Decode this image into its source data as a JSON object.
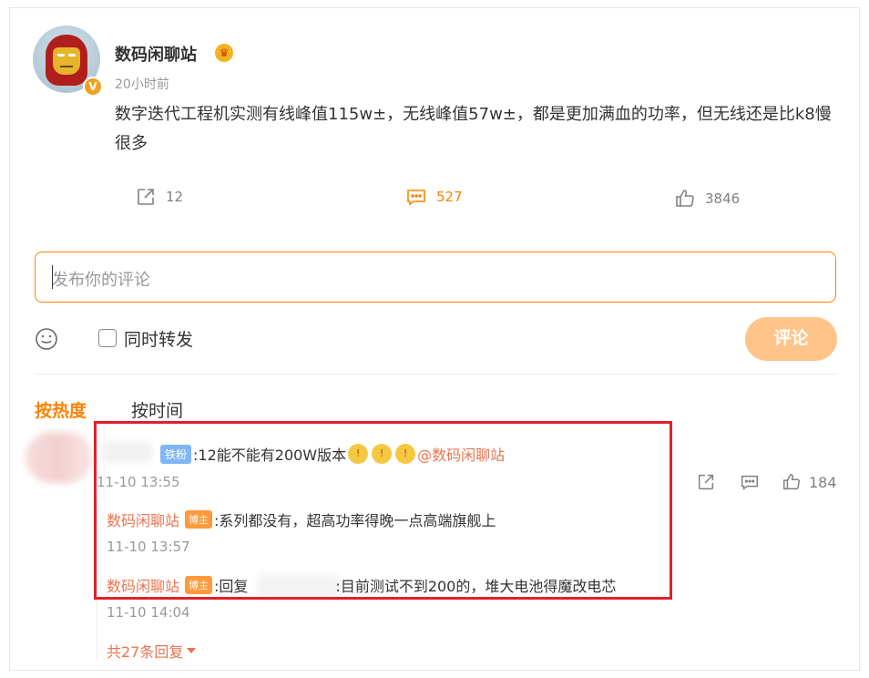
{
  "post": {
    "author": "数码闲聊站",
    "crown_icon": "crown-emoji-icon",
    "verified_icon": "v-verified-icon",
    "time": "20小时前",
    "text": "数字迭代工程机实测有线峰值115w±，无线峰值57w±，都是更加满血的功率，但无线还是比k8慢很多",
    "share_count": "12",
    "comment_count": "527",
    "like_count": "3846"
  },
  "composer": {
    "placeholder": "发布你的评论",
    "repost_label": "同时转发",
    "submit_label": "评论",
    "emoji_icon": "smile-icon"
  },
  "sort": {
    "hot": "按热度",
    "time": "按时间"
  },
  "comment": {
    "fan_badge": "铁粉",
    "text": ":12能不能有200W版本",
    "mention": "@数码闲聊站",
    "time": "11-10 13:55",
    "like_count": "184",
    "replies": [
      {
        "author": "数码闲聊站",
        "badge": "博主",
        "text": ":系列都没有，超高功率得晚一点高端旗舰上",
        "time": "11-10 13:57"
      },
      {
        "author": "数码闲聊站",
        "badge": "博主",
        "prefix": ":回复",
        "text": ":目前测试不到200的，堆大电池得魔改电芯",
        "time": "11-10 14:04"
      }
    ],
    "more_replies": "共27条回复"
  },
  "colors": {
    "accent": "#ff8200",
    "author": "#eb7350",
    "highlight": "#e0202a"
  }
}
